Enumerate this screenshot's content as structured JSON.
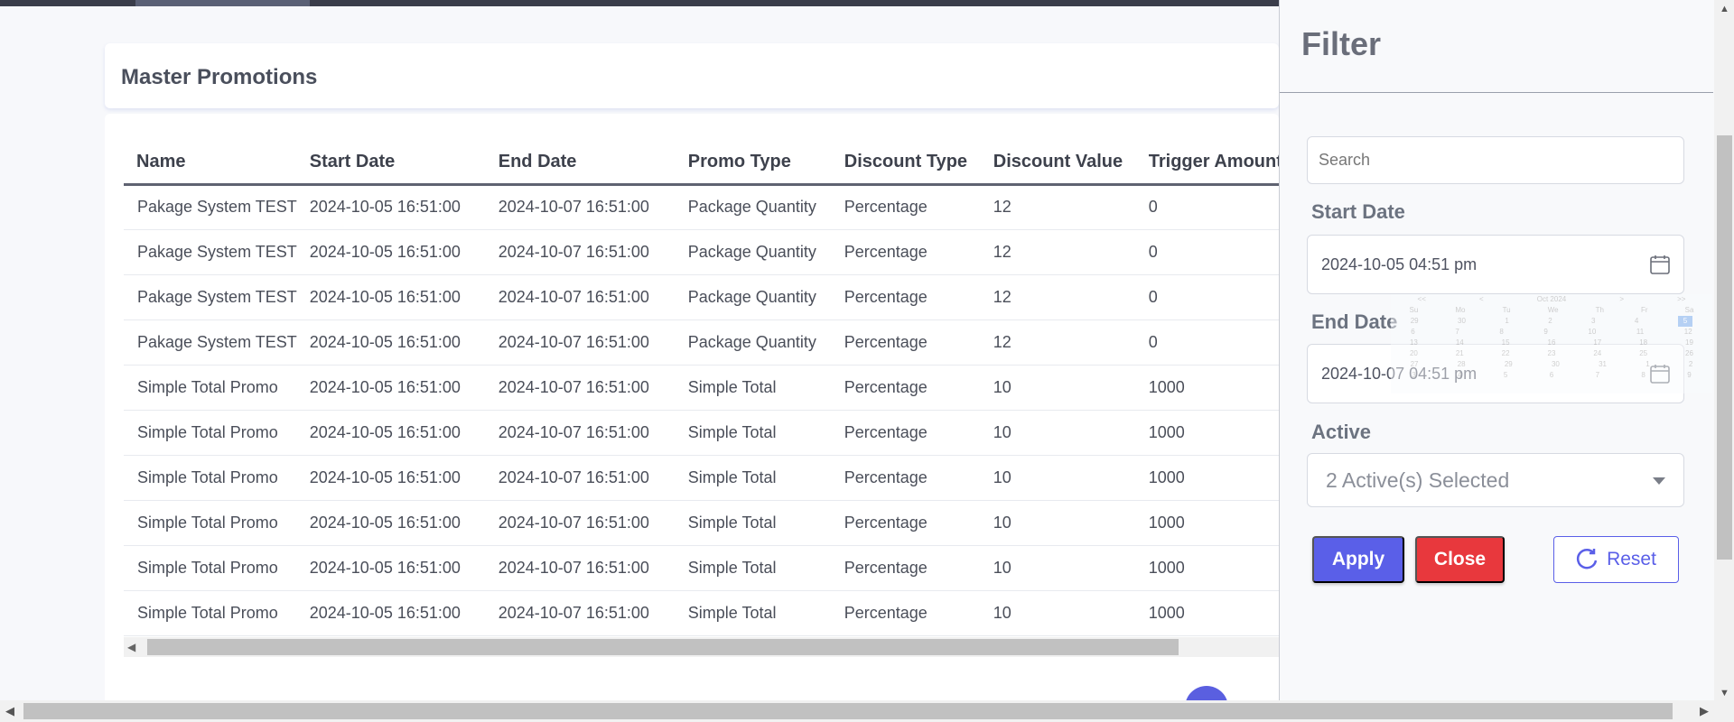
{
  "page": {
    "title": "Master Promotions"
  },
  "table": {
    "columns": [
      "Name",
      "Start Date",
      "End Date",
      "Promo Type",
      "Discount Type",
      "Discount Value",
      "Trigger Amount"
    ],
    "rows": [
      [
        "Pakage System TEST",
        "2024-10-05 16:51:00",
        "2024-10-07 16:51:00",
        "Package Quantity",
        "Percentage",
        "12",
        "0"
      ],
      [
        "Pakage System TEST",
        "2024-10-05 16:51:00",
        "2024-10-07 16:51:00",
        "Package Quantity",
        "Percentage",
        "12",
        "0"
      ],
      [
        "Pakage System TEST",
        "2024-10-05 16:51:00",
        "2024-10-07 16:51:00",
        "Package Quantity",
        "Percentage",
        "12",
        "0"
      ],
      [
        "Pakage System TEST",
        "2024-10-05 16:51:00",
        "2024-10-07 16:51:00",
        "Package Quantity",
        "Percentage",
        "12",
        "0"
      ],
      [
        "Simple Total Promo",
        "2024-10-05 16:51:00",
        "2024-10-07 16:51:00",
        "Simple Total",
        "Percentage",
        "10",
        "1000"
      ],
      [
        "Simple Total Promo",
        "2024-10-05 16:51:00",
        "2024-10-07 16:51:00",
        "Simple Total",
        "Percentage",
        "10",
        "1000"
      ],
      [
        "Simple Total Promo",
        "2024-10-05 16:51:00",
        "2024-10-07 16:51:00",
        "Simple Total",
        "Percentage",
        "10",
        "1000"
      ],
      [
        "Simple Total Promo",
        "2024-10-05 16:51:00",
        "2024-10-07 16:51:00",
        "Simple Total",
        "Percentage",
        "10",
        "1000"
      ],
      [
        "Simple Total Promo",
        "2024-10-05 16:51:00",
        "2024-10-07 16:51:00",
        "Simple Total",
        "Percentage",
        "10",
        "1000"
      ],
      [
        "Simple Total Promo",
        "2024-10-05 16:51:00",
        "2024-10-07 16:51:00",
        "Simple Total",
        "Percentage",
        "10",
        "1000"
      ]
    ]
  },
  "filter": {
    "title": "Filter",
    "search_placeholder": "Search",
    "start_date_label": "Start Date",
    "start_date_value": "2024-10-05 04:51 pm",
    "end_date_label": "End Date",
    "end_date_value": "2024-10-07 04:51 pm",
    "active_label": "Active",
    "active_value": "2 Active(s) Selected",
    "apply_label": "Apply",
    "close_label": "Close",
    "reset_label": "Reset"
  },
  "datepicker": {
    "header": [
      "<<",
      "<",
      "Oct 2024",
      ">",
      ">>"
    ],
    "weekdays": [
      "Su",
      "Mo",
      "Tu",
      "We",
      "Th",
      "Fr",
      "Sa"
    ],
    "weeks": [
      [
        "29",
        "30",
        "1",
        "2",
        "3",
        "4",
        "5"
      ],
      [
        "6",
        "7",
        "8",
        "9",
        "10",
        "11",
        "12"
      ],
      [
        "13",
        "14",
        "15",
        "16",
        "17",
        "18",
        "19"
      ],
      [
        "20",
        "21",
        "22",
        "23",
        "24",
        "25",
        "26"
      ],
      [
        "27",
        "28",
        "29",
        "30",
        "31",
        "1",
        "2"
      ],
      [
        "3",
        "4",
        "5",
        "6",
        "7",
        "8",
        "9"
      ]
    ],
    "selected": "5"
  },
  "colors": {
    "primary": "#5a5fe8",
    "danger": "#e8383d"
  },
  "icons": [
    "calendar-icon",
    "chevron-down-icon",
    "refresh-icon",
    "arrow-left-icon",
    "arrow-right-icon"
  ]
}
